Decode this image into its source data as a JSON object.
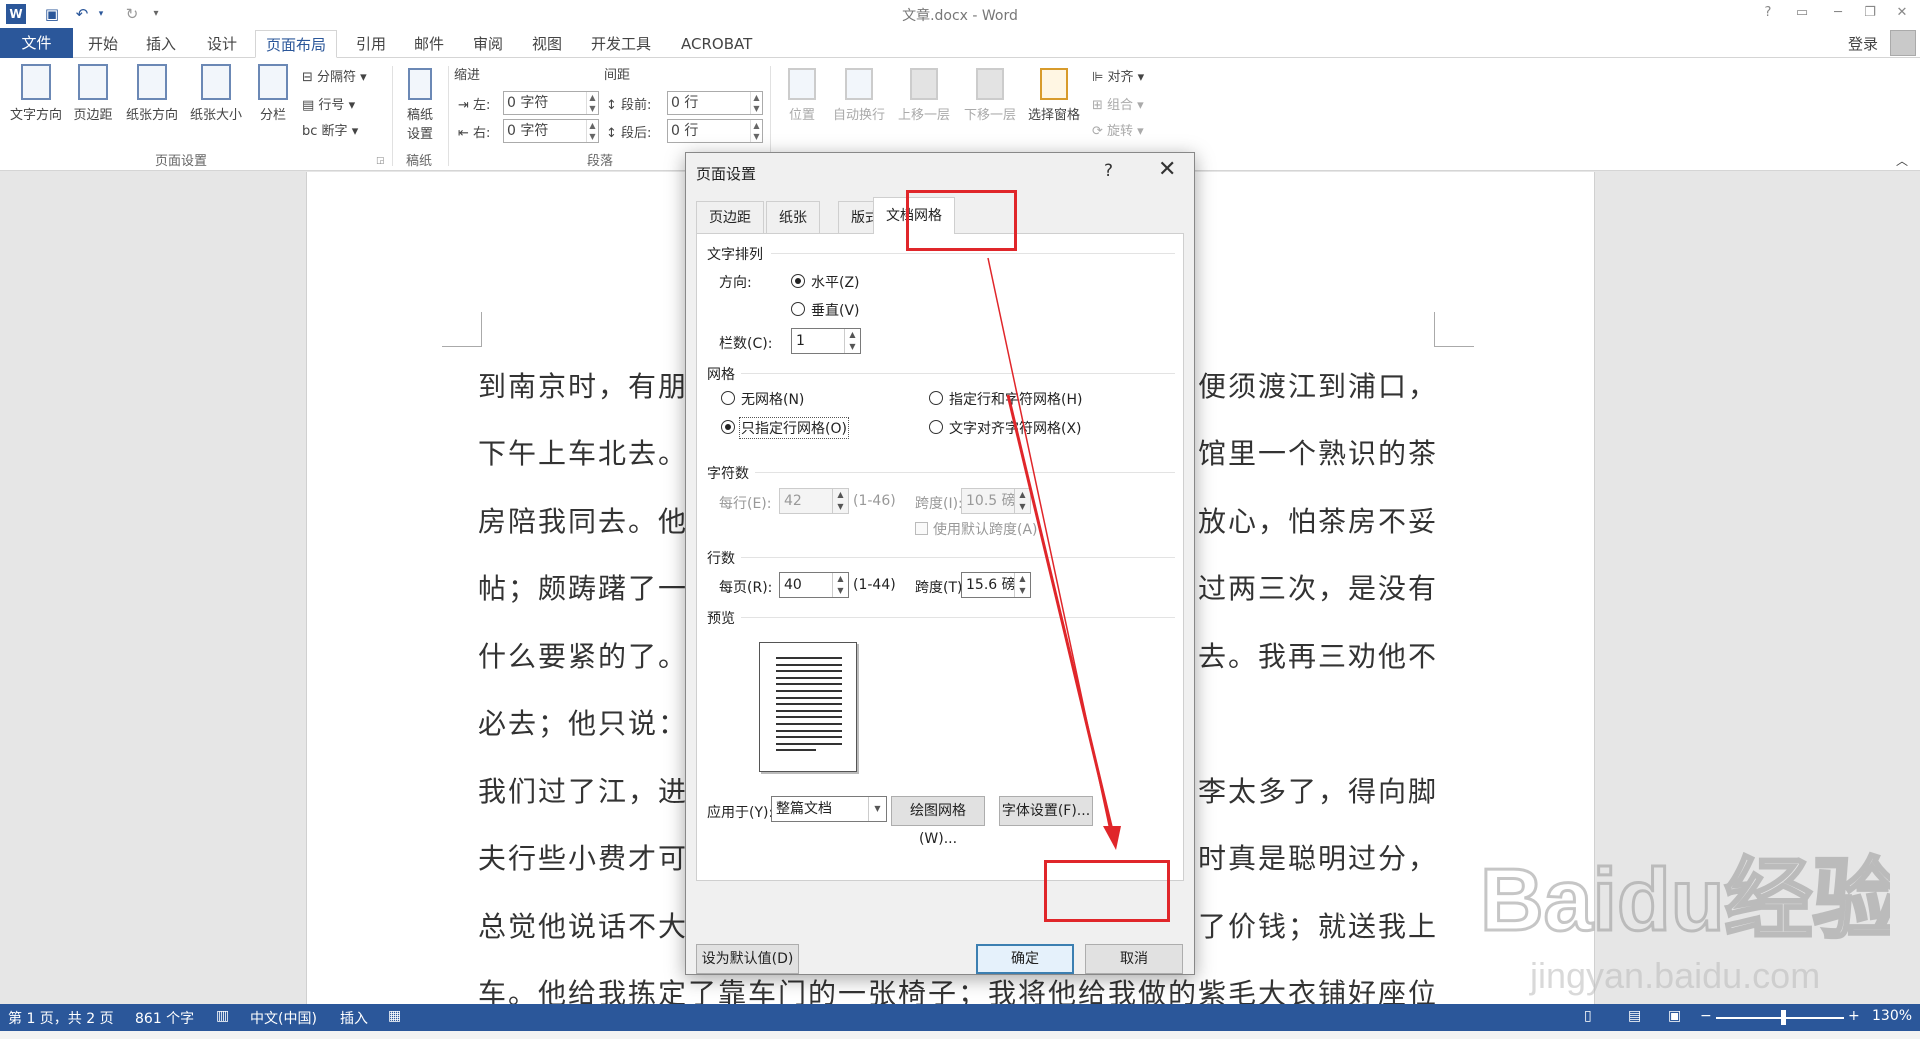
{
  "window": {
    "title": "文章.docx - Word",
    "login": "登录",
    "help": "?"
  },
  "tabs": [
    {
      "label": "文件"
    },
    {
      "label": "开始"
    },
    {
      "label": "插入"
    },
    {
      "label": "设计"
    },
    {
      "label": "页面布局"
    },
    {
      "label": "引用"
    },
    {
      "label": "邮件"
    },
    {
      "label": "审阅"
    },
    {
      "label": "视图"
    },
    {
      "label": "开发工具"
    },
    {
      "label": "ACROBAT"
    }
  ],
  "ribbon": {
    "page_setup": {
      "text_direction": "文字方向",
      "margins": "页边距",
      "orientation": "纸张方向",
      "size": "纸张大小",
      "columns": "分栏",
      "breaks": "分隔符",
      "line_numbers": "行号",
      "hyphenation": "断字",
      "group": "页面设置"
    },
    "manuscript": {
      "label1": "稿纸",
      "label2": "设置",
      "group": "稿纸"
    },
    "paragraph": {
      "indent": "缩进",
      "spacing": "间距",
      "left": "左:",
      "right": "右:",
      "before": "段前:",
      "after": "段后:",
      "left_val": "0 字符",
      "right_val": "0 字符",
      "before_val": "0 行",
      "after_val": "0 行",
      "group": "段落"
    },
    "arrange": {
      "position": "位置",
      "wrap": "自动换行",
      "forward": "上移一层",
      "backward": "下移一层",
      "pane": "选择窗格",
      "align": "对齐",
      "group_btn": "组合",
      "rotate": "旋转"
    }
  },
  "document": {
    "lines": [
      "到南京时，有朋友约去游逛，勾留了一日；第二日上午便须渡江到浦口，",
      "下午上车北去。父亲因为事忙，本已说定不送我，叫旅馆里一个熟识的茶",
      "房陪我同去。他再三嘱咐茶房，甚是仔细。但他终于不放心，怕茶房不妥",
      "帖；颇踌躇了一会。其实我那年已二十岁，北京已来往过两三次，是没有",
      "什么要紧的了。他踌躇了一会，终于决定还是自己送我去。我再三劝他不",
      "必去；他只说：“不要紧，他们去不好！”",
      "我们过了江，进了车站。我买票，他忙着照看行李。行李太多了，得向脚",
      "夫行些小费才可过去。他便又忙着和他们讲价钱。我那时真是聪明过分，",
      "总觉他说话不大漂亮，非自己插嘴不可。但他终于讲定了价钱；就送我上",
      "车。他给我拣定了靠车门的一张椅子；我将他给我做的紫毛大衣铺好座位。"
    ]
  },
  "dialog": {
    "title": "页面设置",
    "help": "?",
    "close": "✕",
    "tabs": [
      {
        "label": "页边距"
      },
      {
        "label": "纸张"
      },
      {
        "label": "版式"
      },
      {
        "label": "文档网格"
      }
    ],
    "text_flow": {
      "section": "文字排列",
      "direction": "方向:",
      "horizontal": "水平(Z)",
      "vertical": "垂直(V)",
      "columns_label": "栏数(C):",
      "columns_value": "1"
    },
    "grid": {
      "section": "网格",
      "no_grid": "无网格(N)",
      "line_char_grid": "指定行和字符网格(H)",
      "line_grid_only": "只指定行网格(O)",
      "text_snap": "文字对齐字符网格(X)"
    },
    "characters": {
      "section": "字符数",
      "per_line": "每行(E):",
      "per_line_value": "42",
      "per_line_range": "(1-46)",
      "pitch": "跨度(I):",
      "pitch_value": "10.5 磅",
      "default_pitch": "使用默认跨度(A)"
    },
    "lines": {
      "section": "行数",
      "per_page": "每页(R):",
      "per_page_value": "40",
      "per_page_range": "(1-44)",
      "pitch": "跨度(T):",
      "pitch_value": "15.6 磅"
    },
    "preview": {
      "section": "预览"
    },
    "apply_to": {
      "label": "应用于(Y):",
      "value": "整篇文档"
    },
    "buttons": {
      "draw_grid": "绘图网格(W)...",
      "font_settings": "字体设置(F)...",
      "set_default": "设为默认值(D)",
      "ok": "确定",
      "cancel": "取消"
    }
  },
  "status": {
    "page": "第 1 页，共 2 页",
    "words": "861 个字",
    "language": "中文(中国)",
    "mode": "插入",
    "zoom": "130%"
  },
  "annotation": {
    "color": "#e0262a"
  },
  "watermark": {
    "text": "Baidu经验",
    "url": "jingyan.baidu.com"
  }
}
